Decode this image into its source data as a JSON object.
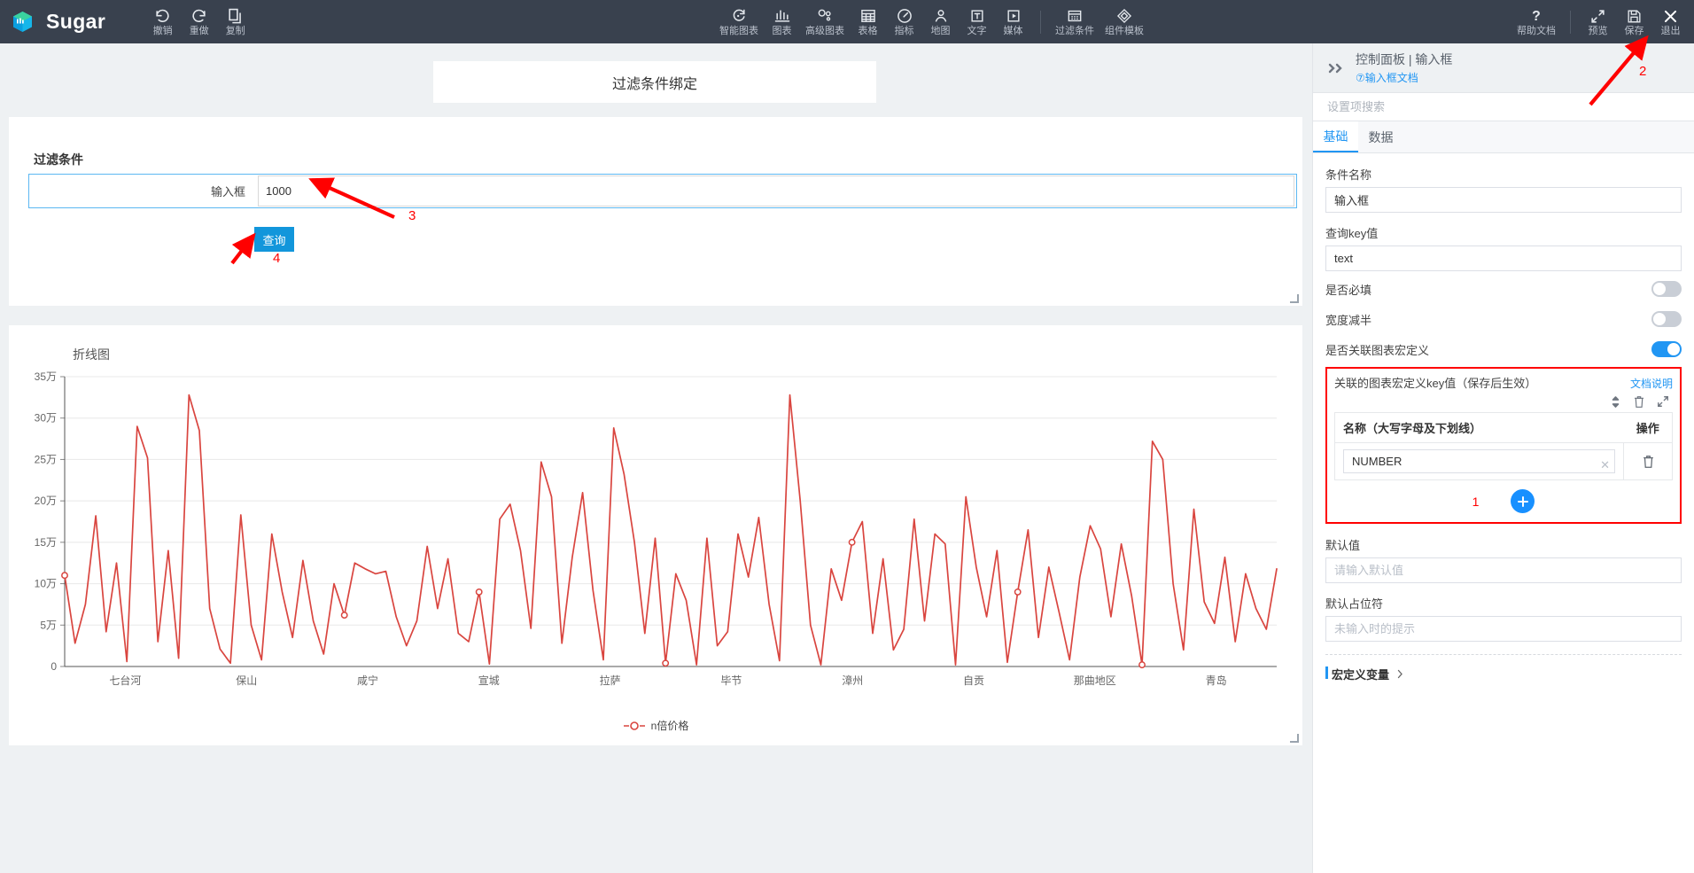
{
  "app": {
    "brand": "Sugar",
    "logo_icon": "sugar-cube-logo"
  },
  "toolbar": {
    "history": [
      {
        "label": "撤销",
        "icon": "undo-icon"
      },
      {
        "label": "重做",
        "icon": "redo-icon"
      },
      {
        "label": "复制",
        "icon": "copy-icon"
      }
    ],
    "components": [
      {
        "label": "智能图表",
        "icon": "smart-chart-icon"
      },
      {
        "label": "图表",
        "icon": "bar-chart-icon"
      },
      {
        "label": "高级图表",
        "icon": "advanced-chart-icon"
      },
      {
        "label": "表格",
        "icon": "table-icon"
      },
      {
        "label": "指标",
        "icon": "gauge-icon"
      },
      {
        "label": "地图",
        "icon": "map-pin-icon"
      },
      {
        "label": "文字",
        "icon": "text-icon"
      },
      {
        "label": "媒体",
        "icon": "media-icon"
      }
    ],
    "extras": [
      {
        "label": "过滤条件",
        "icon": "filter-panel-icon"
      },
      {
        "label": "组件模板",
        "icon": "component-template-icon"
      }
    ],
    "help": {
      "label": "帮助文档",
      "icon": "question-mark-icon"
    },
    "actions": [
      {
        "label": "预览",
        "icon": "expand-arrows-icon"
      },
      {
        "label": "保存",
        "icon": "floppy-save-icon"
      },
      {
        "label": "退出",
        "icon": "close-x-icon"
      }
    ]
  },
  "canvas": {
    "title_card": "过滤条件绑定",
    "filter_panel": {
      "heading": "过滤条件",
      "field_label": "输入框",
      "field_value": "1000",
      "query_button": "查询"
    },
    "chart": {
      "title": "折线图"
    }
  },
  "chart_data": {
    "type": "line",
    "title": "折线图",
    "xlabel": "",
    "ylabel": "",
    "grid": true,
    "legend_position": "bottom",
    "series": [
      {
        "name": "n倍价格",
        "color": "#d9453f",
        "values": [
          110000,
          28000,
          75000,
          182000,
          42000,
          125000,
          6000,
          290000,
          252000,
          30000,
          140000,
          10000,
          328000,
          285000,
          70000,
          21000,
          4000,
          183000,
          50000,
          8000,
          160000,
          90000,
          35000,
          128000,
          55000,
          15000,
          100000,
          62000,
          125000,
          118000,
          112000,
          115000,
          60000,
          25000,
          55000,
          145000,
          70000,
          130000,
          40000,
          30000,
          90000,
          3000,
          178000,
          196000,
          140000,
          46000,
          247000,
          205000,
          28000,
          132000,
          210000,
          92000,
          8000,
          288000,
          232000,
          150000,
          40000,
          155000,
          4000,
          112000,
          80000,
          2000,
          155000,
          25000,
          42000,
          160000,
          108000,
          180000,
          75000,
          7000,
          328000,
          200000,
          50000,
          2000,
          118000,
          80000,
          150000,
          175000,
          40000,
          130000,
          20000,
          45000,
          178000,
          55000,
          160000,
          148000,
          2000,
          205000,
          120000,
          60000,
          140000,
          5000,
          90000,
          165000,
          35000,
          120000,
          65000,
          8000,
          108000,
          170000,
          142000,
          60000,
          148000,
          85000,
          2000,
          272000,
          250000,
          100000,
          20000,
          190000,
          78000,
          52000,
          132000,
          30000,
          112000,
          70000,
          45000,
          118000
        ]
      }
    ],
    "x_tick_labels": [
      "七台河",
      "保山",
      "咸宁",
      "宣城",
      "拉萨",
      "毕节",
      "漳州",
      "自贡",
      "那曲地区",
      "青岛"
    ],
    "y_tick_labels": [
      "0",
      "5万",
      "10万",
      "15万",
      "20万",
      "25万",
      "30万",
      "35万"
    ],
    "ylim": [
      0,
      350000
    ],
    "legend": [
      "n倍价格"
    ]
  },
  "panel": {
    "breadcrumb": "控制面板 | 输入框",
    "doc_link": "⑦输入框文档",
    "collapse_icon": "double-chevron-right-icon",
    "search_placeholder": "设置项搜索",
    "search_value": "",
    "tabs": [
      {
        "label": "基础",
        "active": true
      },
      {
        "label": "数据",
        "active": false
      }
    ],
    "fields": {
      "condition_name_label": "条件名称",
      "condition_name_value": "输入框",
      "query_key_label": "查询key值",
      "query_key_value": "text",
      "default_value_label": "默认值",
      "default_value_placeholder": "请输入默认值",
      "default_value": "",
      "placeholder_label": "默认占位符",
      "placeholder_placeholder": "未输入时的提示",
      "placeholder_value": ""
    },
    "switches": [
      {
        "label": "是否必填",
        "on": false
      },
      {
        "label": "宽度减半",
        "on": false
      },
      {
        "label": "是否关联图表宏定义",
        "on": true
      }
    ],
    "macro": {
      "title": "关联的图表宏定义key值（保存后生效）",
      "doc_label": "文档说明",
      "tools": [
        {
          "icon": "sort-updown-icon"
        },
        {
          "icon": "trash-icon"
        },
        {
          "icon": "expand-diagonal-icon"
        }
      ],
      "columns": [
        "名称（大写字母及下划线）",
        "操作"
      ],
      "rows": [
        {
          "name": "NUMBER",
          "clear_icon": "clear-x-icon",
          "delete_icon": "trash-icon"
        }
      ],
      "add_button_icon": "plus-icon"
    },
    "macro_var_section": {
      "label": "宏定义变量",
      "chevron": "chevron-right-icon"
    }
  },
  "annotations": [
    {
      "number": "1"
    },
    {
      "number": "2"
    },
    {
      "number": "3"
    },
    {
      "number": "4"
    }
  ],
  "colors": {
    "topbar_bg": "#39414e",
    "accent": "#2196f3",
    "chart_line": "#d9453f",
    "annotation": "#ff0000"
  }
}
